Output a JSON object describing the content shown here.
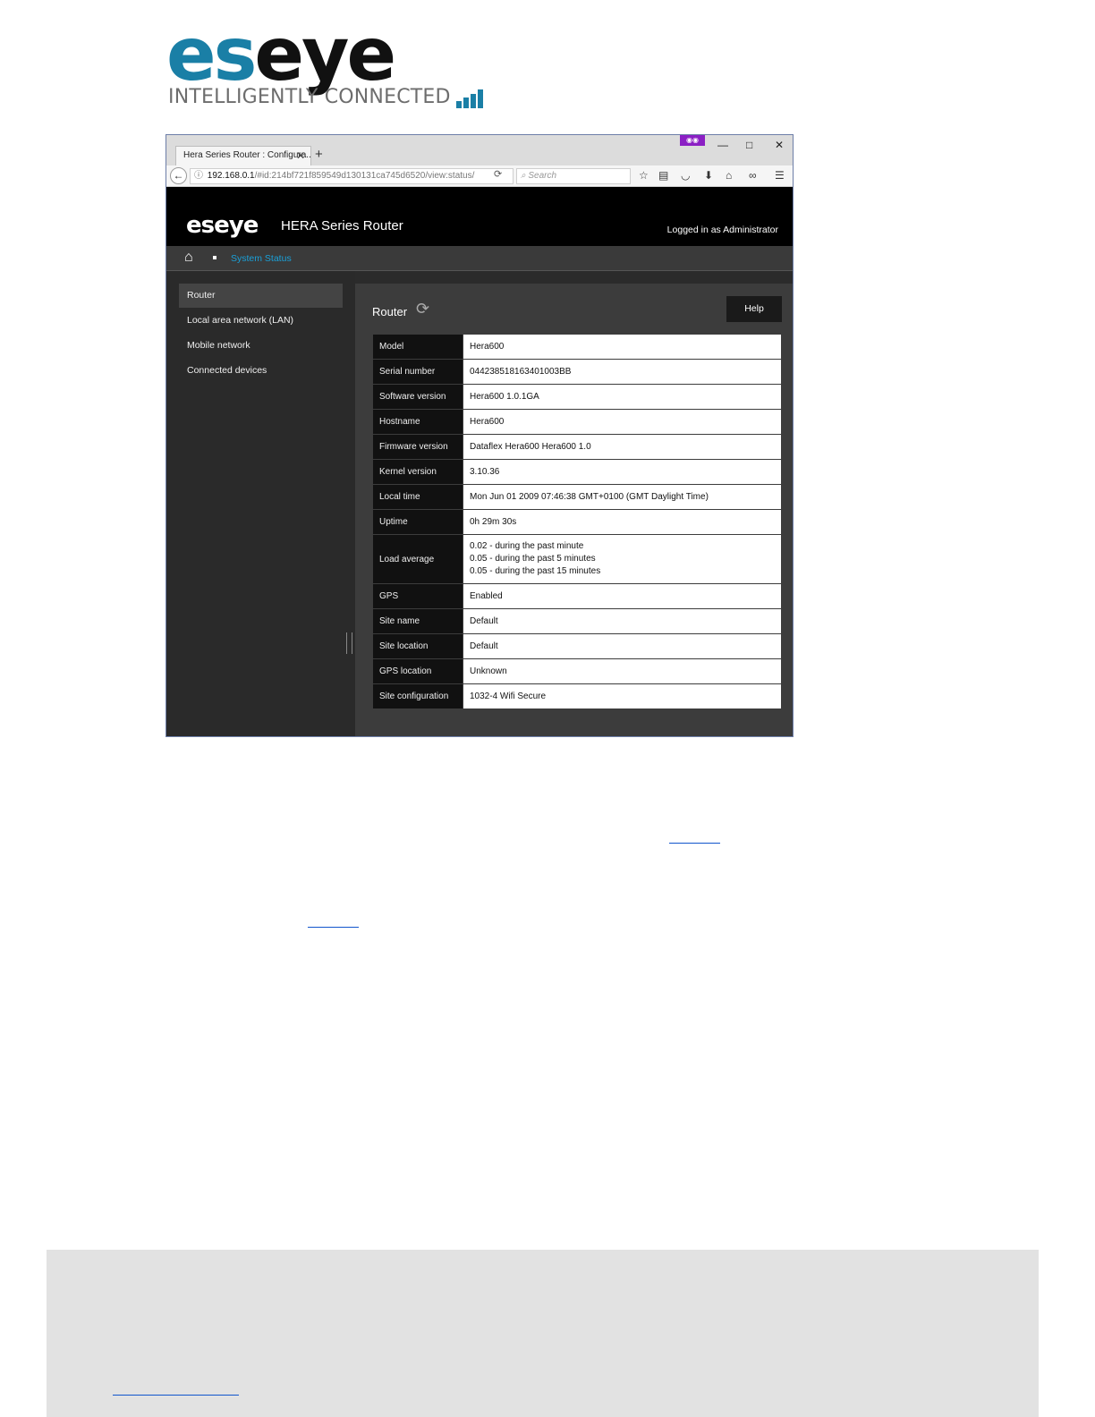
{
  "logo": {
    "brand_a": "es",
    "brand_b": "eye",
    "tagline": "INTELLIGENTLY CONNECTED"
  },
  "browser": {
    "tab_title": "Hera Series Router : Configura...",
    "new_tab": "+",
    "url_host": "192.168.0.1",
    "url_rest": "/#id:214bf721f859549d130131ca745d6520/view:status/",
    "search_placeholder": "Search"
  },
  "app": {
    "logo": "eseye",
    "title": "HERA Series Router",
    "logged_in": "Logged in as Administrator",
    "breadcrumb": "System Status",
    "sidebar": [
      {
        "label": "Router",
        "active": true
      },
      {
        "label": "Local area network (LAN)",
        "active": false
      },
      {
        "label": "Mobile network",
        "active": false
      },
      {
        "label": "Connected devices",
        "active": false
      }
    ],
    "section_title": "Router",
    "help_label": "Help",
    "rows": [
      {
        "key": "Model",
        "value": [
          "Hera600"
        ]
      },
      {
        "key": "Serial number",
        "value": [
          "044238518163401003BB"
        ]
      },
      {
        "key": "Software version",
        "value": [
          "Hera600 1.0.1GA"
        ]
      },
      {
        "key": "Hostname",
        "value": [
          "Hera600"
        ]
      },
      {
        "key": "Firmware version",
        "value": [
          "Dataflex Hera600 Hera600 1.0"
        ]
      },
      {
        "key": "Kernel version",
        "value": [
          "3.10.36"
        ]
      },
      {
        "key": "Local time",
        "value": [
          "Mon Jun 01 2009 07:46:38 GMT+0100 (GMT Daylight Time)"
        ]
      },
      {
        "key": "Uptime",
        "value": [
          "0h 29m 30s"
        ]
      },
      {
        "key": "Load average",
        "value": [
          "0.02 - during the past minute",
          "0.05 - during the past 5 minutes",
          "0.05 - during the past 15 minutes"
        ]
      },
      {
        "key": "GPS",
        "value": [
          "Enabled"
        ]
      },
      {
        "key": "Site name",
        "value": [
          "Default"
        ]
      },
      {
        "key": "Site location",
        "value": [
          "Default"
        ]
      },
      {
        "key": "GPS location",
        "value": [
          "Unknown"
        ]
      },
      {
        "key": "Site configuration",
        "value": [
          "1032-4 Wifi Secure"
        ]
      }
    ]
  },
  "colors": {
    "brand_blue": "#1a7fa6",
    "accent_link": "#1aa0d8",
    "private_badge": "#8b1fc4"
  }
}
